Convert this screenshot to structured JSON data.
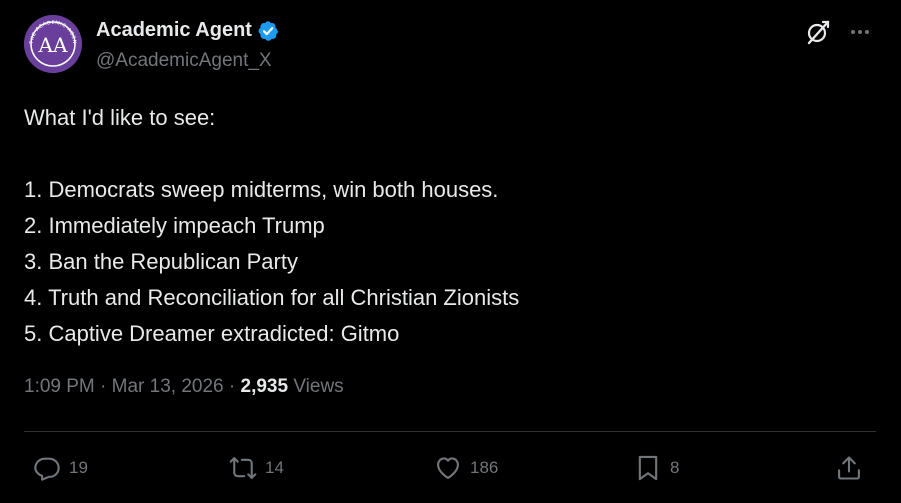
{
  "author": {
    "name": "Academic Agent",
    "handle": "@AcademicAgent_X",
    "avatar_text": "AA",
    "avatar_ring_text": "THE ACADEMIC AGENT",
    "verified": true
  },
  "header_icons": {
    "grok": "grok-icon",
    "more": "more-icon"
  },
  "tweet": {
    "lines": [
      "What I'd like to see:",
      "",
      "1. Democrats sweep midterms, win both houses.",
      "2. Immediately impeach Trump",
      "3. Ban the Republican Party",
      "4. Truth and Reconciliation for all Christian Zionists",
      "5. Captive Dreamer extradicted: Gitmo"
    ]
  },
  "meta": {
    "time": "1:09 PM",
    "separator": " · ",
    "date": "Mar 13, 2026",
    "views_count": "2,935",
    "views_label": " Views"
  },
  "actions": {
    "replies": "19",
    "reposts": "14",
    "likes": "186",
    "bookmarks": "8"
  },
  "colors": {
    "background": "#000000",
    "text_primary": "#e7e9ea",
    "text_secondary": "#71767b",
    "verified_blue": "#1d9bf0",
    "divider": "#2f3336",
    "avatar_purple": "#6a3f9b"
  }
}
